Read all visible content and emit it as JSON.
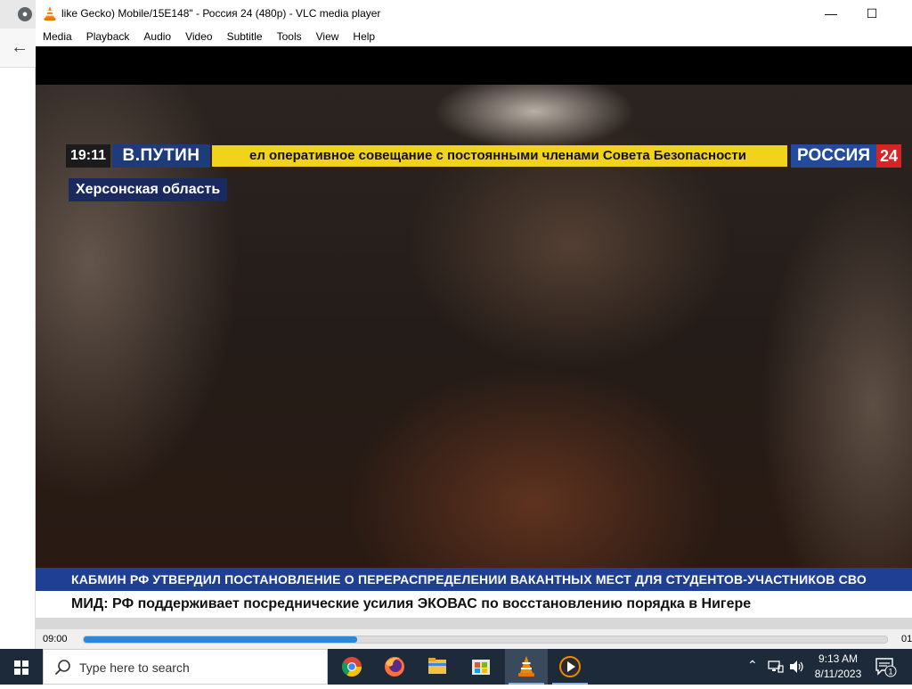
{
  "vlc": {
    "title": "like Gecko) Mobile/15E148\" - Россия 24 (480p) - VLC media player",
    "menu": [
      "Media",
      "Playback",
      "Audio",
      "Video",
      "Subtitle",
      "Tools",
      "View",
      "Help"
    ],
    "window_buttons": {
      "minimize": "—",
      "maximize": "☐"
    }
  },
  "broadcast": {
    "time": "19:11",
    "name": "В.ПУТИН",
    "headline": "ел оперативное совещание с постоянными членами Совета Безопасности",
    "channel": "РОССИЯ",
    "channel_num": "24",
    "region": "Херсонская область",
    "crawl_top": "КАБМИН РФ УТВЕРДИЛ ПОСТАНОВЛЕНИЕ О ПЕРЕРАСПРЕДЕЛЕНИИ ВАКАНТНЫХ МЕСТ ДЛЯ СТУДЕНТОВ-УЧАСТНИКОВ СВО",
    "crawl_bottom": "МИД: РФ поддерживает посреднические усилия ЭКОВАС по восстановлению порядка в Нигере"
  },
  "controls": {
    "elapsed": "09:00",
    "total": "01",
    "progress": 0.34
  },
  "taskbar": {
    "search_placeholder": "Type here to search",
    "clock_time": "9:13 AM",
    "clock_date": "8/11/2023",
    "notifications": "1",
    "apps": [
      "chrome-icon",
      "firefox-icon",
      "file-explorer-icon",
      "store-icon",
      "vlc-icon",
      "media-player-icon"
    ]
  },
  "colors": {
    "accent": "#2f85d6",
    "ticker_yellow": "#f3d31a",
    "channel_blue": "#244a9b",
    "channel_red": "#d82323",
    "taskbar": "#1c2a3a"
  }
}
